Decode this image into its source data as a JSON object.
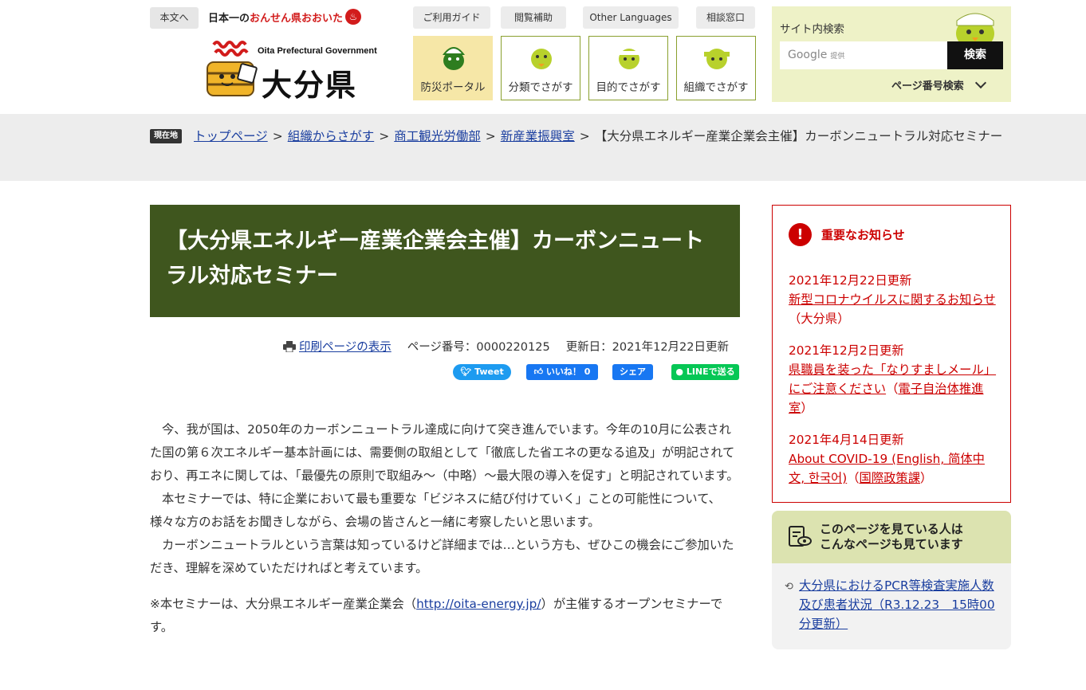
{
  "header": {
    "skip_label": "本文へ",
    "tagline_prefix": "日本一の",
    "tagline_highlight": "おんせん県おおいた",
    "tagline_icon": "♨",
    "logo_en": "Oita Prefectural Government",
    "logo_jp": "大分県",
    "util_links": [
      "ご利用ガイド",
      "閲覧補助",
      "Other Languages",
      "相談窓口"
    ],
    "nav_boxes": [
      "防災ポータル",
      "分類でさがす",
      "目的でさがす",
      "組織でさがす"
    ]
  },
  "search": {
    "title": "サイト内検索",
    "google_label": "Google",
    "google_sub": "提供",
    "button_label": "検索",
    "page_number_search": "ページ番号検索"
  },
  "breadcrumb": {
    "here_label": "現在地",
    "items": [
      "トップページ",
      "組織からさがす",
      "商工観光労働部",
      "新産業振興室"
    ],
    "current": "【大分県エネルギー産業企業会主催】カーボンニュートラル対応セミナー",
    "separator": ">"
  },
  "article": {
    "title": "【大分県エネルギー産業企業会主催】カーボンニュートラル対応セミナー",
    "print_link": "印刷ページの表示",
    "page_number": "ページ番号：0000220125",
    "updated": "更新日：2021年12月22日更新",
    "share": {
      "tweet": "Tweet",
      "like": "いいね！ 0",
      "share": "シェア",
      "line": "LINEで送る"
    },
    "paragraphs": [
      "今、我が国は、2050年のカーボンニュートラル達成に向けて突き進んでいます。今年の10月に公表された国の第６次エネルギー基本計画には、需要側の取組として「徹底した省エネの更なる追及」が明記されており、再エネに関しては、「最優先の原則で取組み～（中略）～最大限の導入を促す」と明記されています。",
      "本セミナーでは、特に企業において最も重要な「ビジネスに結び付けていく」ことの可能性について、様々な方のお話をお聞きしながら、会場の皆さんと一緒に考察したいと思います。",
      "カーボンニュートラルという言葉は知っているけど詳細までは…という方も、ぜひこの機会にご参加いただき、理解を深めていただければと考えています。"
    ],
    "note_prefix": "※本セミナーは、大分県エネルギー産業企業会（",
    "note_link": "http://oita-energy.jp/",
    "note_suffix": "）が主催するオープンセミナーです。"
  },
  "notice": {
    "icon": "!",
    "title": "重要なお知らせ",
    "items": [
      {
        "date": "2021年12月22日更新",
        "link": "新型コロナウイルスに関するお知らせ",
        "suffix": "（大分県）"
      },
      {
        "date": "2021年12月2日更新",
        "link": "県職員を装った「なりすましメール」にご注意ください",
        "suffix_open": "（",
        "suffix_link": "電子自治体推進室",
        "suffix_close": "）"
      },
      {
        "date": "2021年4月14日更新",
        "link": "About COVID-19 (English, 简体中文, 한국어)",
        "suffix_open": "（",
        "suffix_link": "国際政策課",
        "suffix_close": "）"
      }
    ]
  },
  "related": {
    "title_line1": "このページを見ている人は",
    "title_line2": "こんなページも見ています",
    "link": "大分県におけるPCR等検査実施人数及び患者状況（R3.12.23　15時00分更新）"
  },
  "colors": {
    "title_bg": "#3f561e",
    "notice_red": "#cc0000",
    "search_panel_bg": "#eef2c7",
    "related_head_bg": "#dce3b0",
    "link_blue": "#1a3e9f"
  }
}
